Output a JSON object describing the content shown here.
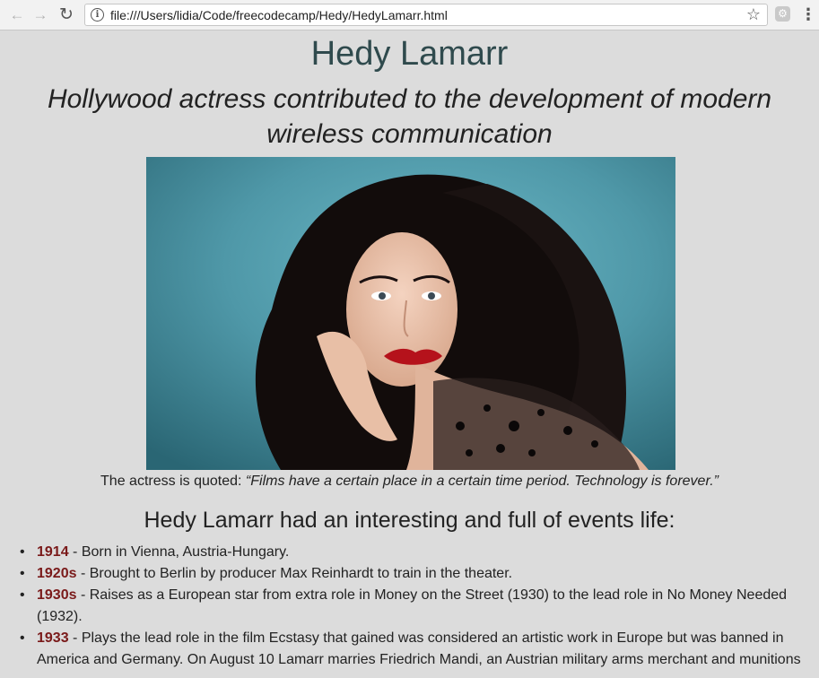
{
  "browser": {
    "url": "file:///Users/lidia/Code/freecodecamp/Hedy/HedyLamarr.html",
    "back_icon": "arrow-left-icon",
    "forward_icon": "arrow-right-icon",
    "reload_icon": "reload-icon",
    "info_icon": "info-icon",
    "bookmark_icon": "star-icon",
    "extension_icon": "extension-icon",
    "menu_icon": "vertical-dots-icon"
  },
  "page": {
    "title": "Hedy Lamarr",
    "subtitle": "Hollywood actress contributed to the development of modern wireless communication",
    "caption_prefix": "The actress is quoted:",
    "quote": "“Films have a certain place in a certain time period. Technology is forever.”",
    "section_heading": "Hedy Lamarr had an interesting and full of events life:",
    "timeline": [
      {
        "year": "1914",
        "text": " - Born in Vienna, Austria-Hungary."
      },
      {
        "year": "1920s",
        "text": " - Brought to Berlin by producer Max Reinhardt to train in the theater."
      },
      {
        "year": "1930s",
        "text": " - Raises as a European star from extra role in Money on the Street (1930) to the lead role in No Money Needed (1932)."
      },
      {
        "year": "1933",
        "text": " - Plays the lead role in the film Ecstasy that gained was considered an artistic work in Europe but was banned in America and Germany. On August 10 Lamarr marries Friedrich Mandi, an Austrian military arms merchant and munitions"
      }
    ]
  },
  "colors": {
    "page_background": "#dcdcdc",
    "title": "#2f4a4d",
    "year": "#7a1a1a"
  }
}
